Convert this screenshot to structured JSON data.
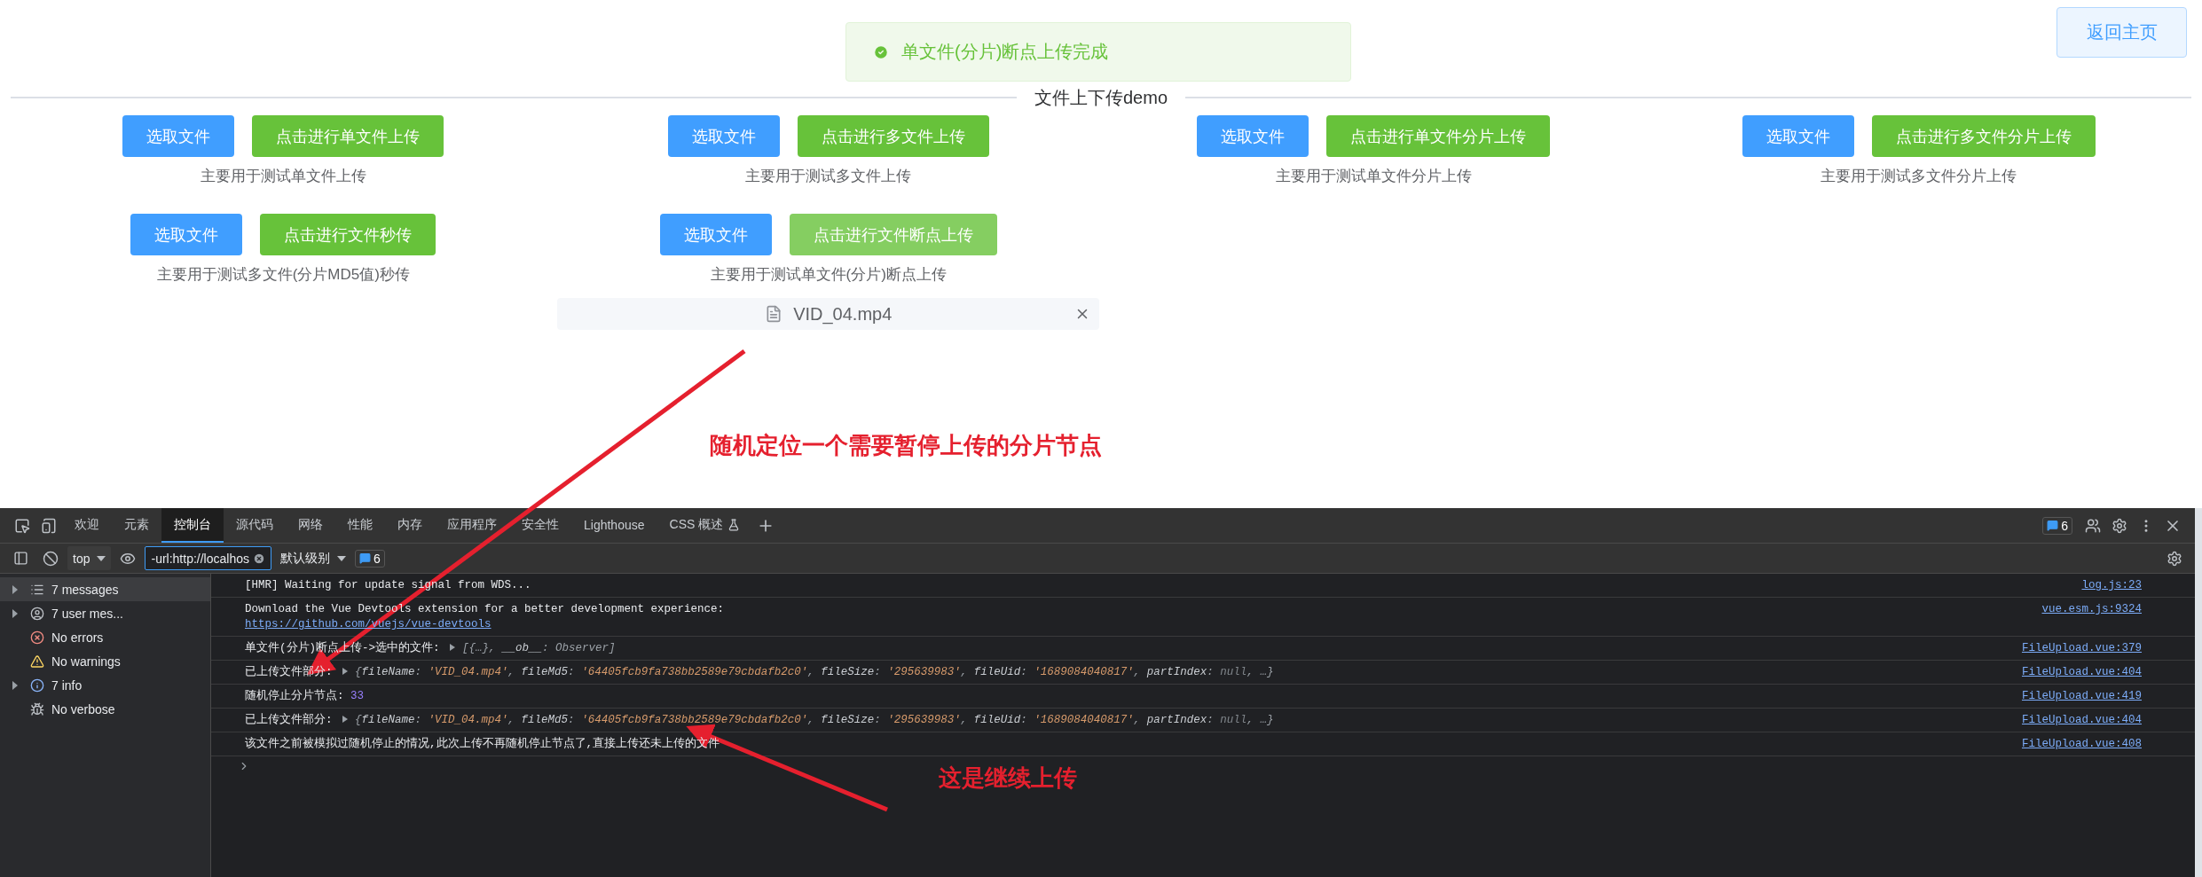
{
  "toast": {
    "text": "单文件(分片)断点上传完成"
  },
  "home_button": {
    "label": "返回主页"
  },
  "divider_title": "文件上下传demo",
  "columns": [
    {
      "groups": [
        {
          "buttons": [
            {
              "label": "选取文件",
              "kind": "primary",
              "focused": false
            },
            {
              "label": "点击进行单文件上传",
              "kind": "success",
              "focused": false
            }
          ],
          "caption": "主要用于测试单文件上传"
        },
        {
          "buttons": [
            {
              "label": "选取文件",
              "kind": "primary",
              "focused": false
            },
            {
              "label": "点击进行文件秒传",
              "kind": "success",
              "focused": false
            }
          ],
          "caption": "主要用于测试多文件(分片MD5值)秒传"
        }
      ]
    },
    {
      "groups": [
        {
          "buttons": [
            {
              "label": "选取文件",
              "kind": "primary",
              "focused": false
            },
            {
              "label": "点击进行多文件上传",
              "kind": "success",
              "focused": false
            }
          ],
          "caption": "主要用于测试多文件上传"
        },
        {
          "buttons": [
            {
              "label": "选取文件",
              "kind": "primary",
              "focused": false
            },
            {
              "label": "点击进行文件断点上传",
              "kind": "success",
              "focused": true
            }
          ],
          "caption": "主要用于测试单文件(分片)断点上传",
          "files": [
            {
              "name": "VID_04.mp4"
            }
          ]
        }
      ]
    },
    {
      "groups": [
        {
          "buttons": [
            {
              "label": "选取文件",
              "kind": "primary",
              "focused": false
            },
            {
              "label": "点击进行单文件分片上传",
              "kind": "success",
              "focused": false
            }
          ],
          "caption": "主要用于测试单文件分片上传"
        }
      ]
    },
    {
      "groups": [
        {
          "buttons": [
            {
              "label": "选取文件",
              "kind": "primary",
              "focused": false
            },
            {
              "label": "点击进行多文件分片上传",
              "kind": "success",
              "focused": false
            }
          ],
          "caption": "主要用于测试多文件分片上传"
        }
      ]
    }
  ],
  "annotations": [
    {
      "text": "随机定位一个需要暂停上传的分片节点"
    },
    {
      "text": "这是继续上传"
    }
  ],
  "devtools": {
    "tabs": [
      {
        "label": "欢迎",
        "selected": false,
        "experimental": false
      },
      {
        "label": "元素",
        "selected": false,
        "experimental": false
      },
      {
        "label": "控制台",
        "selected": true,
        "experimental": false
      },
      {
        "label": "源代码",
        "selected": false,
        "experimental": false
      },
      {
        "label": "网络",
        "selected": false,
        "experimental": false
      },
      {
        "label": "性能",
        "selected": false,
        "experimental": false
      },
      {
        "label": "内存",
        "selected": false,
        "experimental": false
      },
      {
        "label": "应用程序",
        "selected": false,
        "experimental": false
      },
      {
        "label": "安全性",
        "selected": false,
        "experimental": false
      },
      {
        "label": "Lighthouse",
        "selected": false,
        "experimental": false
      },
      {
        "label": "CSS 概述",
        "selected": false,
        "experimental": true
      }
    ],
    "issues_count": "6",
    "toolbar": {
      "context": "top",
      "filter": "-url:http://localhos",
      "level": "默认级别",
      "issues_count": "6"
    },
    "sidebar": [
      {
        "label": "7 messages",
        "kind": "messages",
        "expandable": true,
        "selected": true
      },
      {
        "label": "7 user mes...",
        "kind": "user",
        "expandable": true,
        "selected": false
      },
      {
        "label": "No errors",
        "kind": "error",
        "expandable": false,
        "selected": false
      },
      {
        "label": "No warnings",
        "kind": "warning",
        "expandable": false,
        "selected": false
      },
      {
        "label": "7 info",
        "kind": "info",
        "expandable": true,
        "selected": false
      },
      {
        "label": "No verbose",
        "kind": "verbose",
        "expandable": false,
        "selected": false
      }
    ],
    "messages": [
      {
        "text": "[HMR] Waiting for update signal from WDS...",
        "source": "log.js:23"
      },
      {
        "text": "Download the Vue Devtools extension for a better development experience:",
        "url": "https://github.com/vuejs/vue-devtools",
        "source": "vue.esm.js:9324"
      },
      {
        "text": "单文件(分片)断点上传->选中的文件: ",
        "preview": [
          {
            "text": "[{…}, ",
            "kind": "punct"
          },
          {
            "text": "__ob__",
            "kind": "key"
          },
          {
            "text": ": ",
            "kind": "punct"
          },
          {
            "text": "Observer",
            "kind": "punct"
          },
          {
            "text": "]",
            "kind": "punct"
          }
        ],
        "source": "FileUpload.vue:379"
      },
      {
        "text": "已上传文件部分: ",
        "preview": [
          {
            "text": "{",
            "kind": "punct"
          },
          {
            "text": "fileName",
            "kind": "key"
          },
          {
            "text": ": ",
            "kind": "punct"
          },
          {
            "text": "'VID_04.mp4'",
            "kind": "string"
          },
          {
            "text": ", ",
            "kind": "punct"
          },
          {
            "text": "fileMd5",
            "kind": "key"
          },
          {
            "text": ": ",
            "kind": "punct"
          },
          {
            "text": "'64405fcb9fa738bb2589e79cbdafb2c0'",
            "kind": "string"
          },
          {
            "text": ", ",
            "kind": "punct"
          },
          {
            "text": "fileSize",
            "kind": "key"
          },
          {
            "text": ": ",
            "kind": "punct"
          },
          {
            "text": "'295639983'",
            "kind": "string"
          },
          {
            "text": ", ",
            "kind": "punct"
          },
          {
            "text": "fileUid",
            "kind": "key"
          },
          {
            "text": ": ",
            "kind": "punct"
          },
          {
            "text": "'1689084040817'",
            "kind": "string"
          },
          {
            "text": ", ",
            "kind": "punct"
          },
          {
            "text": "partIndex",
            "kind": "key"
          },
          {
            "text": ": ",
            "kind": "punct"
          },
          {
            "text": "null",
            "kind": "null"
          },
          {
            "text": ", …}",
            "kind": "punct"
          }
        ],
        "source": "FileUpload.vue:404"
      },
      {
        "text": "随机停止分片节点: ",
        "number": "33",
        "source": "FileUpload.vue:419"
      },
      {
        "text": "已上传文件部分: ",
        "preview": [
          {
            "text": "{",
            "kind": "punct"
          },
          {
            "text": "fileName",
            "kind": "key"
          },
          {
            "text": ": ",
            "kind": "punct"
          },
          {
            "text": "'VID_04.mp4'",
            "kind": "string"
          },
          {
            "text": ", ",
            "kind": "punct"
          },
          {
            "text": "fileMd5",
            "kind": "key"
          },
          {
            "text": ": ",
            "kind": "punct"
          },
          {
            "text": "'64405fcb9fa738bb2589e79cbdafb2c0'",
            "kind": "string"
          },
          {
            "text": ", ",
            "kind": "punct"
          },
          {
            "text": "fileSize",
            "kind": "key"
          },
          {
            "text": ": ",
            "kind": "punct"
          },
          {
            "text": "'295639983'",
            "kind": "string"
          },
          {
            "text": ", ",
            "kind": "punct"
          },
          {
            "text": "fileUid",
            "kind": "key"
          },
          {
            "text": ": ",
            "kind": "punct"
          },
          {
            "text": "'1689084040817'",
            "kind": "string"
          },
          {
            "text": ", ",
            "kind": "punct"
          },
          {
            "text": "partIndex",
            "kind": "key"
          },
          {
            "text": ": ",
            "kind": "punct"
          },
          {
            "text": "null",
            "kind": "null"
          },
          {
            "text": ", …}",
            "kind": "punct"
          }
        ],
        "source": "FileUpload.vue:404"
      },
      {
        "text": "该文件之前被模拟过随机停止的情况,此次上传不再随机停止节点了,直接上传还未上传的文件",
        "source": "FileUpload.vue:408"
      }
    ]
  }
}
